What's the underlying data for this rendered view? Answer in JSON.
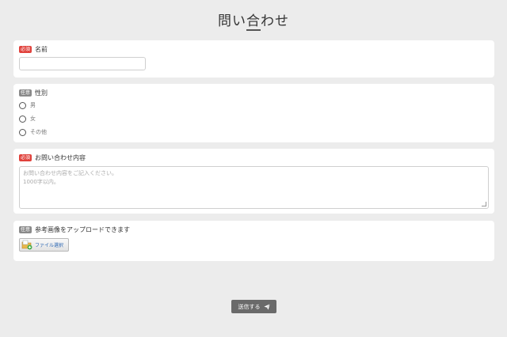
{
  "page": {
    "title": "問い合わせ"
  },
  "badges": {
    "required": "必須",
    "optional": "任意"
  },
  "fields": {
    "name": {
      "label": "名前",
      "value": ""
    },
    "gender": {
      "label": "性別",
      "options": [
        "男",
        "女",
        "その他"
      ]
    },
    "message": {
      "label": "お問い合わせ内容",
      "placeholder_line1": "お問い合わせ内容をご記入ください。",
      "placeholder_line2": "1000字以内。"
    },
    "image": {
      "label": "参考画像をアップロードできます",
      "button_label": "ファイル選択"
    }
  },
  "submit": {
    "label": "送信する",
    "icon": "paper-plane-icon"
  },
  "colors": {
    "required_badge": "#e0413b",
    "optional_badge": "#8a8a8a",
    "submit_bg": "#6a6a6a"
  }
}
